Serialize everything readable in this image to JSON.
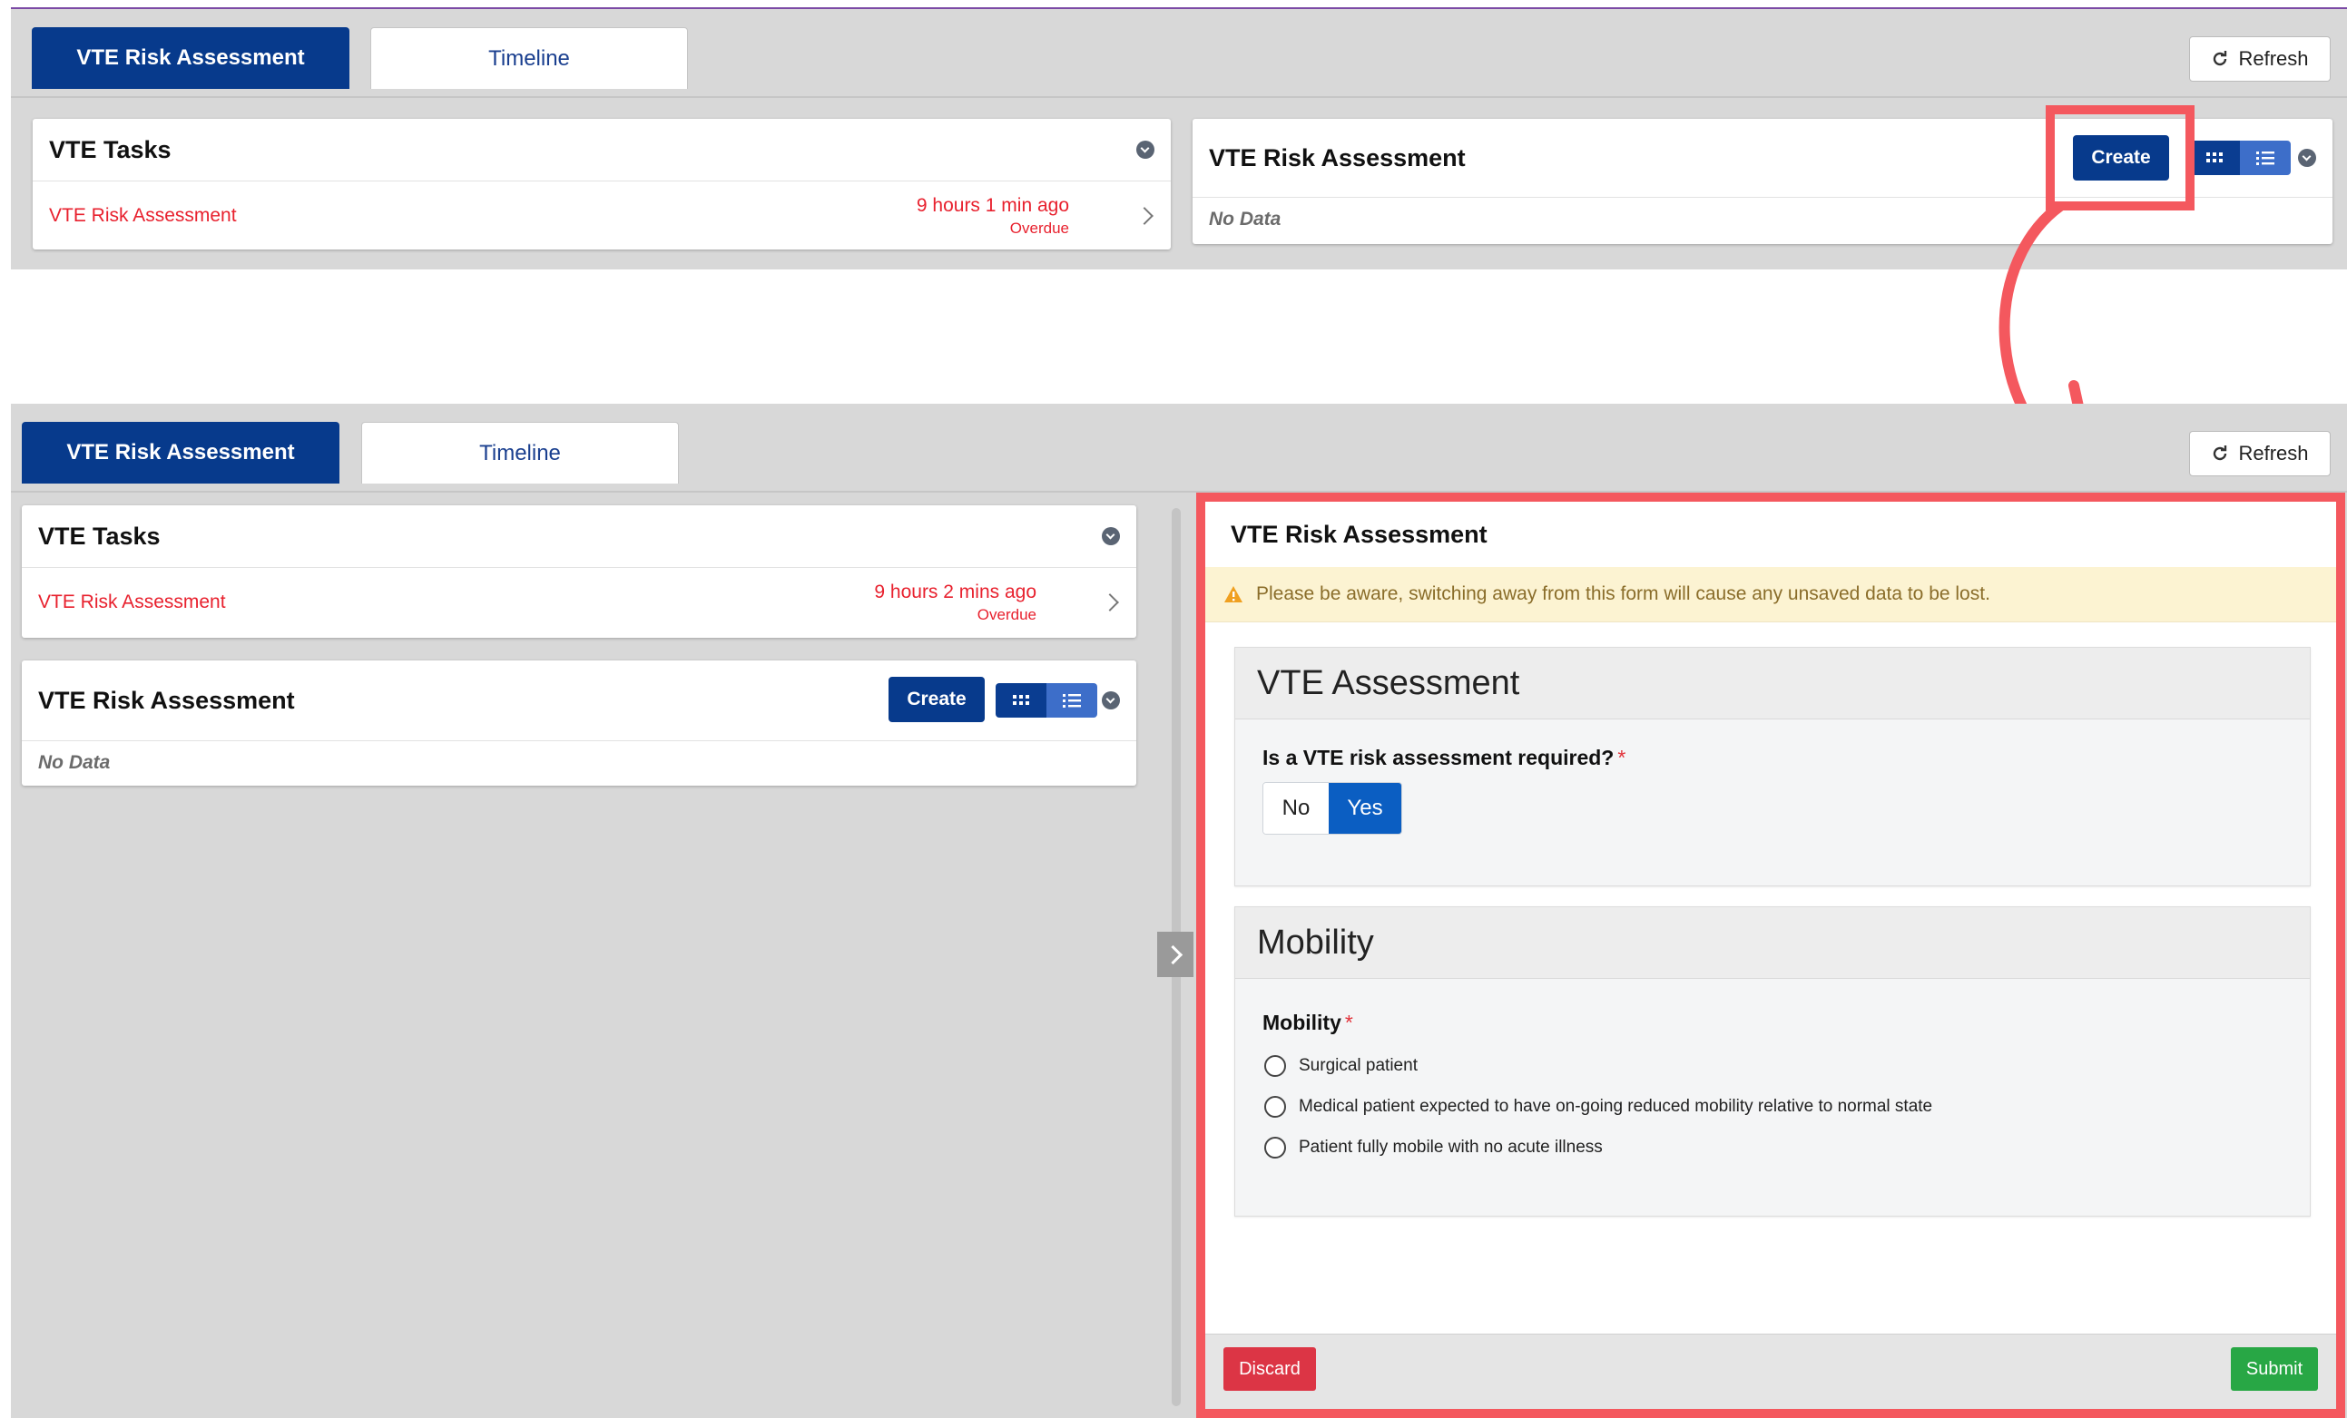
{
  "top_view": {
    "tabs": [
      {
        "label": "VTE Risk Assessment",
        "active": true
      },
      {
        "label": "Timeline",
        "active": false
      }
    ],
    "refresh_label": "Refresh",
    "tasks_card": {
      "title": "VTE Tasks",
      "task_label": "VTE Risk Assessment",
      "time": "9 hours 1 min ago",
      "status": "Overdue"
    },
    "assessment_card": {
      "title": "VTE Risk Assessment",
      "create_label": "Create",
      "empty": "No Data"
    }
  },
  "bottom_view": {
    "tabs": [
      {
        "label": "VTE Risk Assessment",
        "active": true
      },
      {
        "label": "Timeline",
        "active": false
      }
    ],
    "refresh_label": "Refresh",
    "tasks_card": {
      "title": "VTE Tasks",
      "task_label": "VTE Risk Assessment",
      "time": "9 hours 2 mins ago",
      "status": "Overdue"
    },
    "assessment_card": {
      "title": "VTE Risk Assessment",
      "create_label": "Create",
      "empty": "No Data"
    },
    "form": {
      "title": "VTE Risk Assessment",
      "warning": "Please be aware, switching away from this form will cause any unsaved data to be lost.",
      "sections": [
        {
          "title": "VTE Assessment",
          "question": "Is a VTE risk assessment required?",
          "required_mark": "*",
          "options": [
            "No",
            "Yes"
          ],
          "selected": "Yes"
        },
        {
          "title": "Mobility",
          "question": "Mobility",
          "required_mark": "*",
          "options": [
            "Surgical patient",
            "Medical patient expected to have on-going reduced mobility relative to normal state",
            "Patient fully mobile with no acute illness"
          ]
        }
      ],
      "discard_label": "Discard",
      "submit_label": "Submit"
    }
  },
  "colors": {
    "primary": "#073a8c",
    "alert_red": "#e8212e",
    "highlight": "#f4585e",
    "discard": "#dc3545",
    "submit": "#28a745",
    "warning_bg": "#fcf3d2"
  },
  "icons": [
    "refresh-icon",
    "chevron-down-circle-icon",
    "chevron-right-icon",
    "grid-view-icon",
    "list-view-icon",
    "warning-icon",
    "radio-icon",
    "splitter-chevron-icon",
    "curved-arrow-icon"
  ]
}
